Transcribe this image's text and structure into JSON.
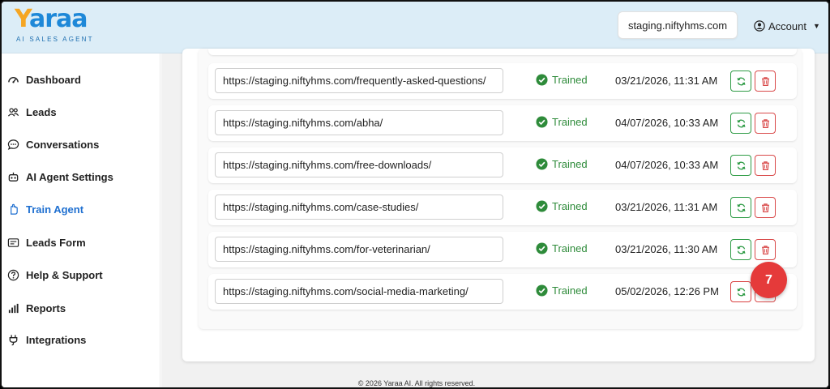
{
  "brand": {
    "name_first": "Y",
    "name_rest": "araa",
    "tagline": "AI SALES AGENT"
  },
  "header": {
    "domain": "staging.niftyhms.com",
    "account_label": "Account"
  },
  "sidebar": {
    "items": [
      {
        "label": "Dashboard",
        "icon": "dashboard-icon"
      },
      {
        "label": "Leads",
        "icon": "users-icon"
      },
      {
        "label": "Conversations",
        "icon": "chat-icon"
      },
      {
        "label": "AI Agent Settings",
        "icon": "robot-icon"
      },
      {
        "label": "Train Agent",
        "icon": "hand-icon",
        "active": true
      },
      {
        "label": "Leads Form",
        "icon": "form-icon"
      },
      {
        "label": "Help & Support",
        "icon": "question-icon"
      },
      {
        "label": "Reports",
        "icon": "bar-chart-icon"
      },
      {
        "label": "Integrations",
        "icon": "plug-icon"
      }
    ]
  },
  "pages": {
    "rows": [
      {
        "url": "https://staging.niftyhms.com/frequently-asked-questions/",
        "status": "Trained",
        "date": "03/21/2026, 11:31 AM"
      },
      {
        "url": "https://staging.niftyhms.com/abha/",
        "status": "Trained",
        "date": "04/07/2026, 10:33 AM"
      },
      {
        "url": "https://staging.niftyhms.com/free-downloads/",
        "status": "Trained",
        "date": "04/07/2026, 10:33 AM"
      },
      {
        "url": "https://staging.niftyhms.com/case-studies/",
        "status": "Trained",
        "date": "03/21/2026, 11:31 AM"
      },
      {
        "url": "https://staging.niftyhms.com/for-veterinarian/",
        "status": "Trained",
        "date": "03/21/2026, 11:30 AM"
      },
      {
        "url": "https://staging.niftyhms.com/social-media-marketing/",
        "status": "Trained",
        "date": "05/02/2026, 12:26 PM"
      }
    ]
  },
  "annotation": {
    "step": "7"
  },
  "footer": {
    "text": "© 2026 Yaraa AI. All rights reserved."
  },
  "colors": {
    "accent": "#1e6fd0",
    "trained": "#2e8b3a",
    "delete": "#d94a4a",
    "badge": "#e53a3a"
  }
}
